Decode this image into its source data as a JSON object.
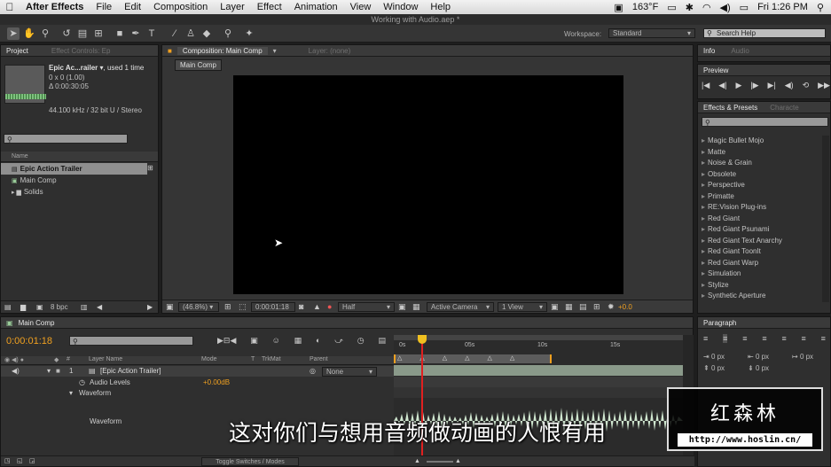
{
  "menubar": {
    "app": "After Effects",
    "items": [
      "File",
      "Edit",
      "Composition",
      "Layer",
      "Effect",
      "Animation",
      "View",
      "Window",
      "Help"
    ],
    "temperature": "163°F",
    "clock": "Fri 1:26 PM"
  },
  "window_title": "Working with Audio.aep *",
  "workspace": {
    "label": "Workspace:",
    "value": "Standard"
  },
  "search_help": {
    "placeholder": "Search Help"
  },
  "project": {
    "tab": "Project",
    "tab2": "Effect Controls: Ep",
    "item_name": "Epic Ac...railer ▾",
    "used": ", used 1 time",
    "dims": "0 x 0 (1.00)",
    "duration": "Δ 0:00:30:05",
    "audio_info": "44.100 kHz / 32 bit U / Stereo",
    "col_name": "Name",
    "items": [
      {
        "label": "Epic Action Trailer",
        "selected": true,
        "icon": "audio-file-icon"
      },
      {
        "label": "Main Comp",
        "selected": false,
        "icon": "composition-icon"
      },
      {
        "label": "Solids",
        "selected": false,
        "icon": "folder-icon"
      }
    ],
    "bpc": "8 bpc"
  },
  "composition": {
    "tab": "Composition: Main Comp",
    "layer_tab": "Layer: (none)",
    "crumb": "Main Comp",
    "zoom": "(46.8%)",
    "timecode": "0:00:01:18",
    "resolution": "Half",
    "camera": "Active Camera",
    "view": "1 View",
    "exposure": "+0.0"
  },
  "info_tabs": [
    "Info",
    "Audio"
  ],
  "preview_tab": "Preview",
  "effects": {
    "tab": "Effects & Presets",
    "tab2": "Characte",
    "items": [
      "Magic Bullet Mojo",
      "Matte",
      "Noise & Grain",
      "Obsolete",
      "Perspective",
      "Primatte",
      "RE:Vision Plug-ins",
      "Red Giant",
      "Red Giant Psunami",
      "Red Giant Text Anarchy",
      "Red Giant ToonIt",
      "Red Giant Warp",
      "Simulation",
      "Stylize",
      "Synthetic Aperture"
    ]
  },
  "paragraph": {
    "tab": "Paragraph",
    "values": [
      "0 px",
      "0 px",
      "0 px",
      "0 px",
      "0 px"
    ]
  },
  "timeline": {
    "tab": "Main Comp",
    "timecode": "0:00:01:18",
    "columns": {
      "layer_name": "Layer Name",
      "mode": "Mode",
      "t": "T",
      "trkmat": "TrkMat",
      "parent": "Parent"
    },
    "layer": {
      "num": "1",
      "name": "[Epic Action Trailer]",
      "parent": "None"
    },
    "audio_levels_label": "Audio Levels",
    "audio_levels_value": "+0.00dB",
    "waveform_group": "Waveform",
    "waveform_sub": "Waveform",
    "ruler": [
      "0s",
      "05s",
      "10s",
      "15s"
    ],
    "toggle": "Toggle Switches / Modes"
  },
  "overlay": {
    "subtitle": "这对你们与想用音频做动画的人恨有用",
    "watermark_title": "红森林",
    "watermark_url": "http://www.hoslin.cn/"
  }
}
